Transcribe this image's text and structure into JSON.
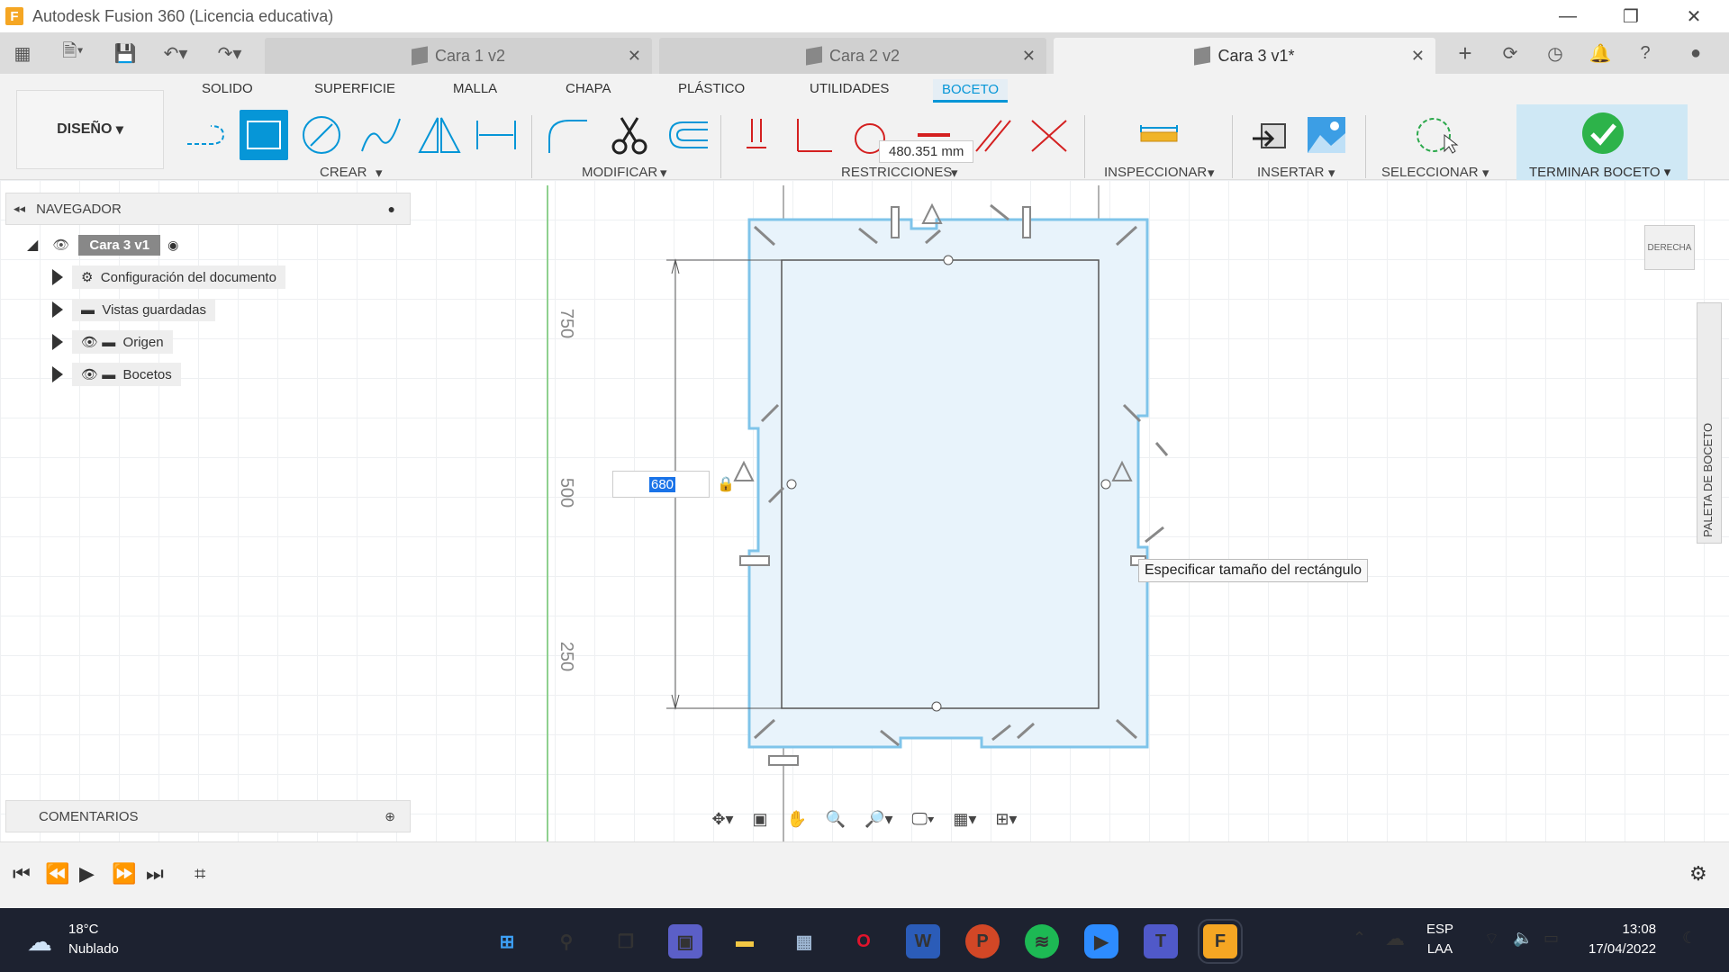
{
  "window": {
    "title": "Autodesk Fusion 360 (Licencia educativa)",
    "app_logo": "F"
  },
  "tabs": [
    {
      "label": "Cara 1 v2",
      "active": false
    },
    {
      "label": "Cara 2 v2",
      "active": false
    },
    {
      "label": "Cara 3 v1*",
      "active": true
    }
  ],
  "ribbon_tabs": [
    "SOLIDO",
    "SUPERFICIE",
    "MALLA",
    "CHAPA",
    "PLÁSTICO",
    "UTILIDADES",
    "BOCETO"
  ],
  "toolbar": {
    "design": "DISEÑO",
    "groups": [
      "CREAR",
      "MODIFICAR",
      "RESTRICCIONES",
      "INSPECCIONAR",
      "INSERTAR",
      "SELECCIONAR",
      "TERMINAR BOCETO"
    ]
  },
  "navigator": {
    "title": "NAVEGADOR",
    "root": "Cara 3 v1",
    "items": [
      "Configuración del documento",
      "Vistas guardadas",
      "Origen",
      "Bocetos"
    ]
  },
  "comments": {
    "title": "COMENTARIOS"
  },
  "sketch": {
    "dimension_input": "680",
    "length_readout": "480.351 mm",
    "tooltip": "Especificar tamaño del rectángulo",
    "ruler_labels": [
      "750",
      "500",
      "250"
    ]
  },
  "viewcube": {
    "label": "DERECHA"
  },
  "palette": {
    "label": "PALETA DE BOCETO"
  },
  "taskbar": {
    "weather_temp": "18°C",
    "weather_desc": "Nublado",
    "lang_top": "ESP",
    "lang_bottom": "LAA",
    "time": "13:08",
    "date": "17/04/2022"
  },
  "colors": {
    "accent": "#0696d7",
    "sketch_fill": "#e8f3fb",
    "sketch_line": "#7fc4ea",
    "taskbar": "#1d2230"
  }
}
